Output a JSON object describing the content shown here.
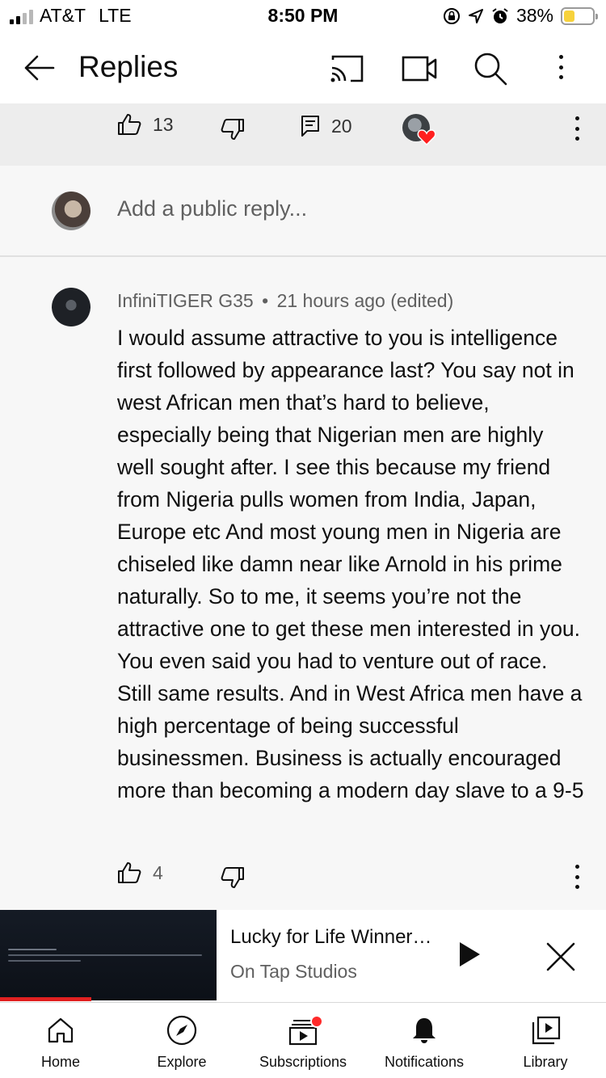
{
  "status_bar": {
    "carrier": "AT&T",
    "network": "LTE",
    "time": "8:50 PM",
    "battery": "38%"
  },
  "app_bar": {
    "title": "Replies"
  },
  "parent_comment": {
    "likes": "13",
    "replies": "20"
  },
  "reply_input": {
    "placeholder": "Add a public reply..."
  },
  "comment": {
    "author": "InfiniTIGER G35",
    "separator": "•",
    "time": "21 hours ago (edited)",
    "text": "I would assume attractive to you is intelligence first followed by appearance last? You say not in west African men that’s hard to believe, especially being that Nigerian men are highly well sought after. I see this because my friend from Nigeria pulls women from India, Japan, Europe etc And most young men in Nigeria are chiseled like damn near like Arnold in his prime naturally. So to me, it seems you’re not the attractive one to get these men interested in you. You even said you had to venture out of race. Still same results. And in West Africa men have a high percentage of being successful businessmen. Business is actually encouraged more than becoming a modern day slave to a 9-5",
    "likes": "4"
  },
  "mini_player": {
    "title": "Lucky for Life Winner…",
    "channel": "On Tap Studios",
    "progress": 0.15
  },
  "bottom_nav": {
    "home": "Home",
    "explore": "Explore",
    "subscriptions": "Subscriptions",
    "notifications": "Notifications",
    "library": "Library"
  }
}
